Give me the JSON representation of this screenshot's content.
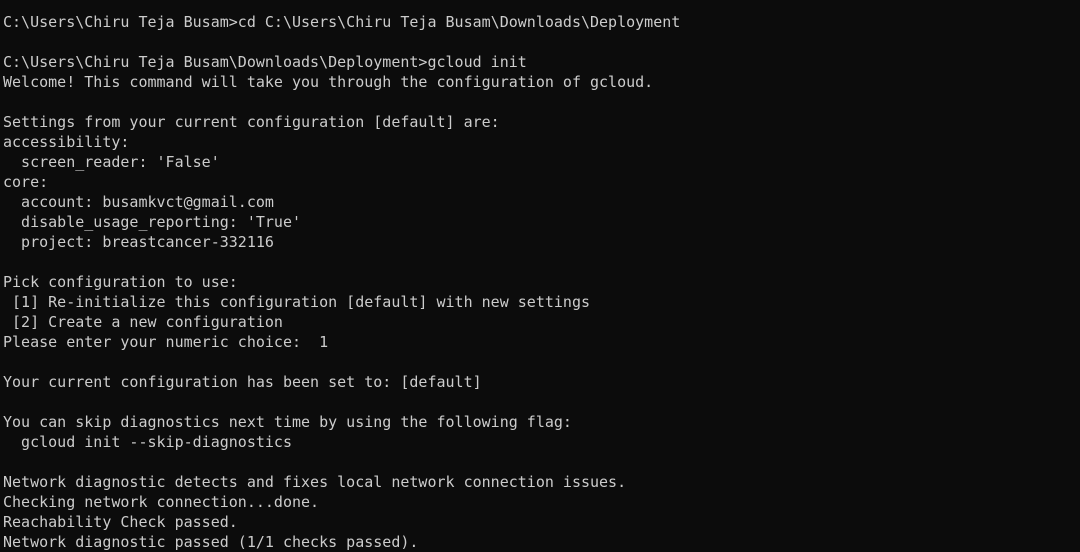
{
  "terminal": {
    "background": "#0c0c0c",
    "foreground": "#cccccc",
    "lines": [
      "C:\\Users\\Chiru Teja Busam>cd C:\\Users\\Chiru Teja Busam\\Downloads\\Deployment",
      "",
      "C:\\Users\\Chiru Teja Busam\\Downloads\\Deployment>gcloud init",
      "Welcome! This command will take you through the configuration of gcloud.",
      "",
      "Settings from your current configuration [default] are:",
      "accessibility:",
      "  screen_reader: 'False'",
      "core:",
      "  account: busamkvct@gmail.com",
      "  disable_usage_reporting: 'True'",
      "  project: breastcancer-332116",
      "",
      "Pick configuration to use:",
      " [1] Re-initialize this configuration [default] with new settings",
      " [2] Create a new configuration",
      "Please enter your numeric choice:  1",
      "",
      "Your current configuration has been set to: [default]",
      "",
      "You can skip diagnostics next time by using the following flag:",
      "  gcloud init --skip-diagnostics",
      "",
      "Network diagnostic detects and fixes local network connection issues.",
      "Checking network connection...done.",
      "Reachability Check passed.",
      "Network diagnostic passed (1/1 checks passed)."
    ]
  }
}
